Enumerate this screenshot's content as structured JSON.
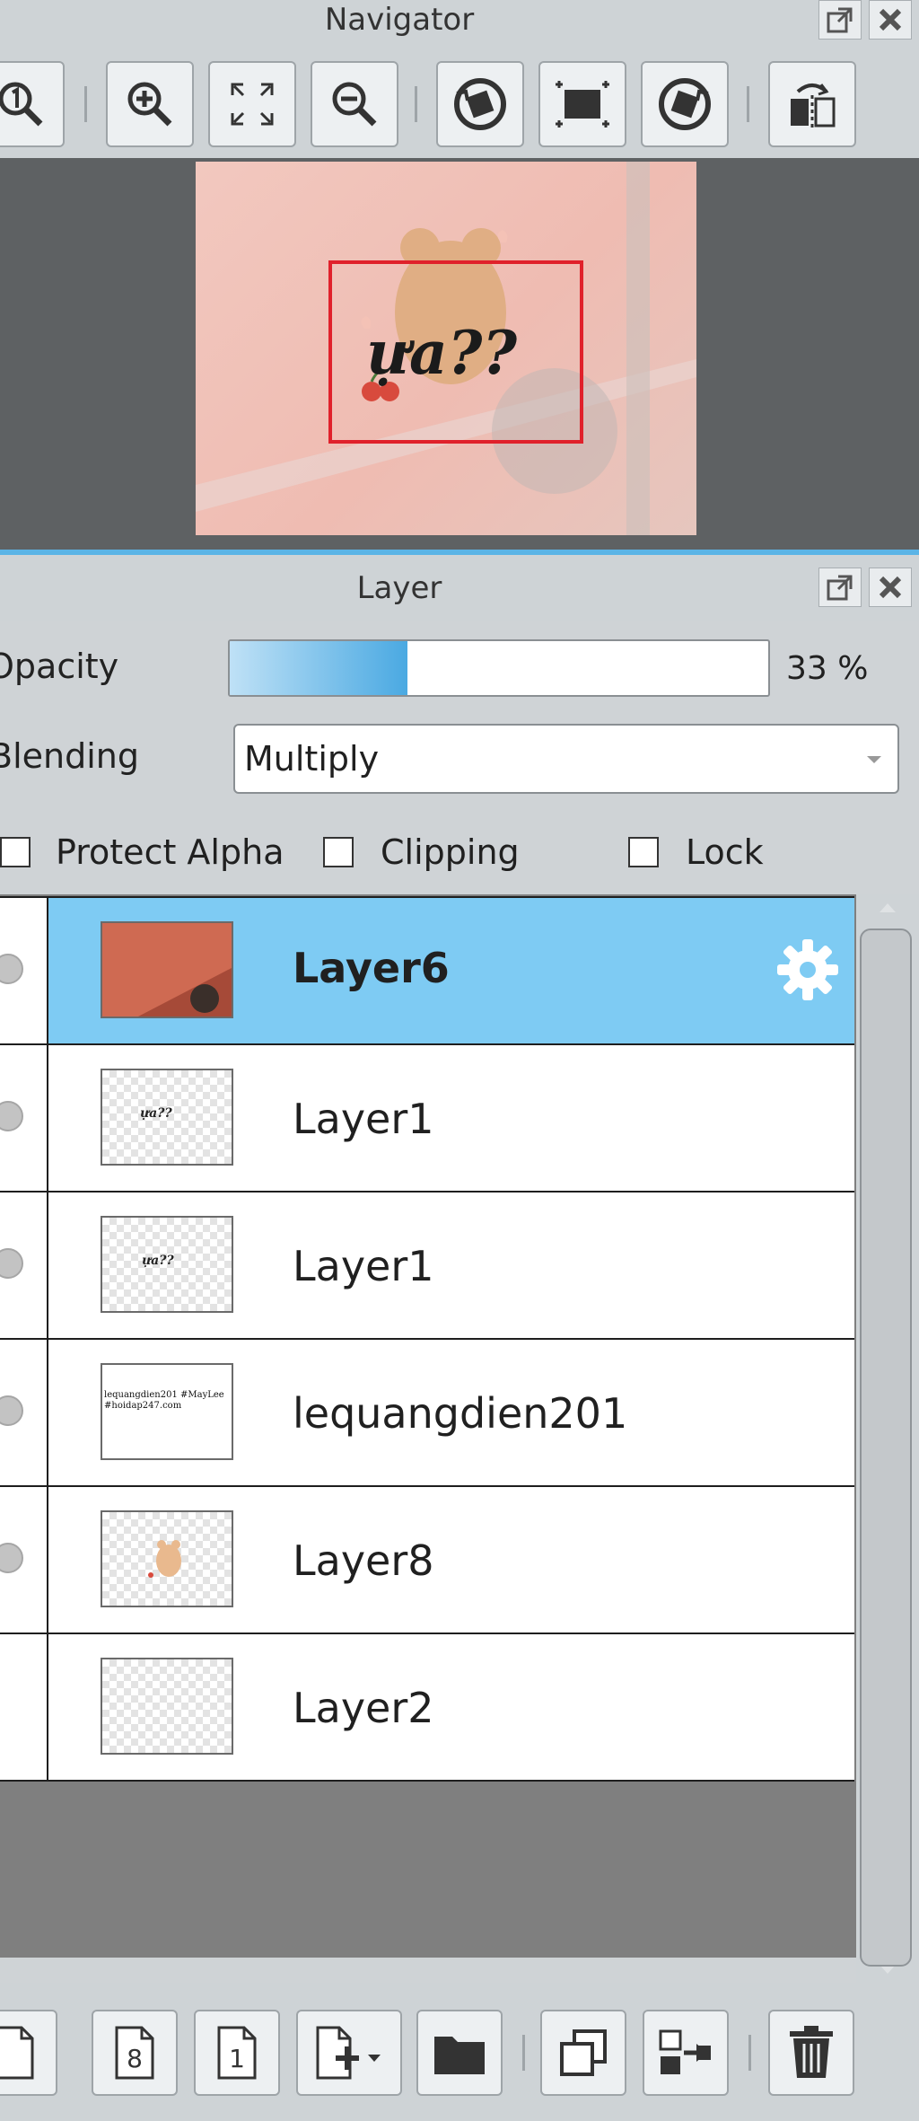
{
  "navigator": {
    "title": "Navigator",
    "toolbar": [
      {
        "name": "zoom-actual-icon"
      },
      {
        "name": "zoom-in-icon"
      },
      {
        "name": "fit-to-window-icon"
      },
      {
        "name": "zoom-out-icon"
      },
      {
        "name": "rotate-left-icon"
      },
      {
        "name": "reset-view-icon"
      },
      {
        "name": "rotate-right-icon"
      },
      {
        "name": "flip-horizontal-icon"
      }
    ],
    "preview_text": "ựa??"
  },
  "layer_panel": {
    "title": "Layer",
    "opacity_label": "Opacity",
    "opacity_value": "33 %",
    "opacity_fraction": 0.33,
    "blending_label": "Blending",
    "blending_value": "Multiply",
    "protect_alpha_label": "Protect Alpha",
    "clipping_label": "Clipping",
    "lock_label": "Lock",
    "layers": [
      {
        "name": "Layer6",
        "selected": true
      },
      {
        "name": "Layer1",
        "thumb_text": "ựa??"
      },
      {
        "name": "Layer1",
        "thumb_text": "ựa??"
      },
      {
        "name": "lequangdien201",
        "thumb_text": "lequangdien201 #MayLee #hoidap247.com"
      },
      {
        "name": "Layer8"
      },
      {
        "name": "Layer2"
      }
    ]
  },
  "bottom_toolbar": [
    {
      "name": "new-layer-icon"
    },
    {
      "name": "new-8bit-layer-icon"
    },
    {
      "name": "new-1bit-layer-icon"
    },
    {
      "name": "add-layer-menu-icon"
    },
    {
      "name": "new-folder-icon"
    },
    {
      "name": "duplicate-layer-icon"
    },
    {
      "name": "merge-down-icon"
    },
    {
      "name": "delete-layer-icon"
    }
  ]
}
